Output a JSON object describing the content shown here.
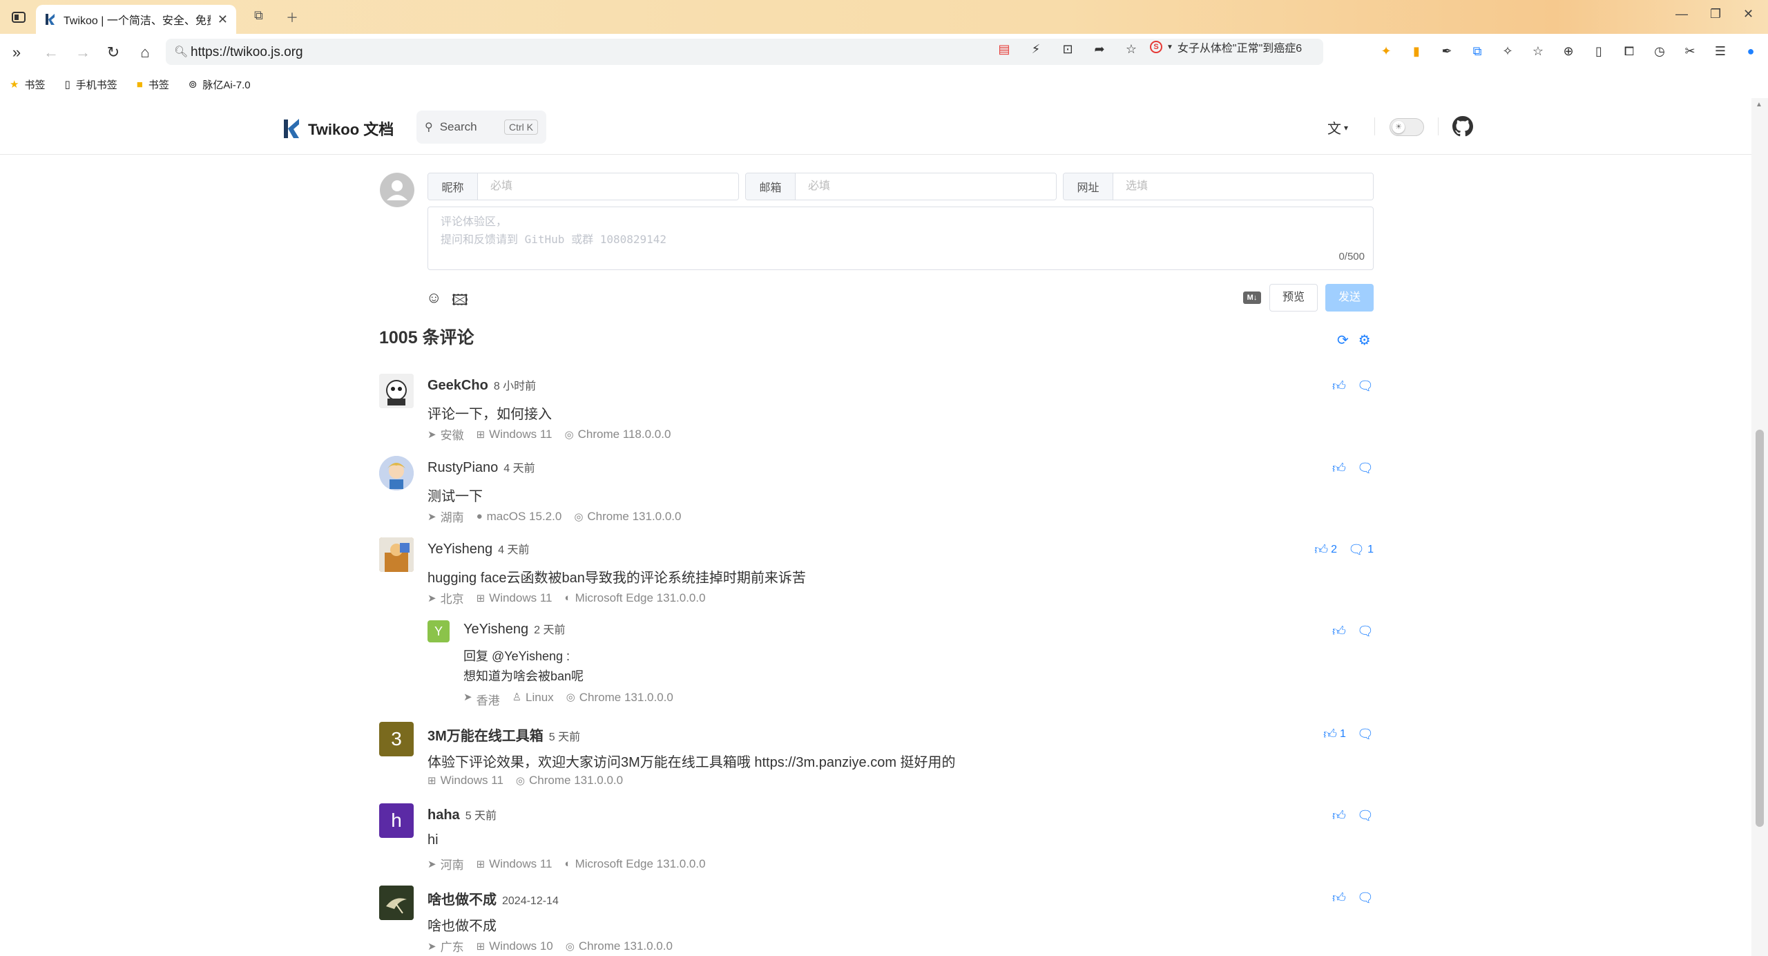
{
  "browser": {
    "tab_title": "Twikoo | 一个简洁、安全、免费",
    "url": "https://twikoo.js.org",
    "news_text": "女子从体检\"正常\"到癌症6",
    "bookmarks": [
      {
        "icon": "star-icon",
        "label": "书签"
      },
      {
        "icon": "phone-icon",
        "label": "手机书签"
      },
      {
        "icon": "folder-icon",
        "label": "书签"
      },
      {
        "icon": "bot-icon",
        "label": "脉亿Ai-7.0"
      }
    ]
  },
  "site": {
    "logo_text": "Twikoo 文档",
    "search_label": "Search",
    "search_kbd": "Ctrl K"
  },
  "form": {
    "nick_label": "昵称",
    "nick_placeholder": "必填",
    "mail_label": "邮箱",
    "mail_placeholder": "必填",
    "link_label": "网址",
    "link_placeholder": "选填",
    "textarea_placeholder": "评论体验区，\n提问和反馈请到 GitHub 或群 1080829142",
    "counter": "0/500",
    "md_label": "M↓",
    "preview_label": "预览",
    "send_label": "发送"
  },
  "comments_header": {
    "count_text": "1005 条评论"
  },
  "comments": [
    {
      "nick": "GeekCho",
      "time": "8 小时前",
      "content": "评论一下，如何接入",
      "location": "安徽",
      "os": "Windows 11",
      "browser": "Chrome 118.0.0.0",
      "likes": "",
      "replies": "",
      "avatar_letter": "",
      "avatar_color": "#e8e8e8"
    },
    {
      "nick": "RustyPiano",
      "time": "4 天前",
      "content": "测试一下",
      "location": "湖南",
      "os": "macOS 15.2.0",
      "browser": "Chrome 131.0.0.0",
      "likes": "",
      "replies": "",
      "avatar_letter": "",
      "avatar_color": "#b7c9e8"
    },
    {
      "nick": "YeYisheng",
      "time": "4 天前",
      "content": "hugging face云函数被ban导致我的评论系统挂掉时期前来诉苦",
      "location": "北京",
      "os": "Windows 11",
      "browser": "Microsoft Edge 131.0.0.0",
      "likes": "2",
      "replies": "1",
      "avatar_letter": "",
      "avatar_color": "#d9a25a"
    },
    {
      "nick": "3M万能在线工具箱",
      "time": "5 天前",
      "content": "体验下评论效果，欢迎大家访问3M万能在线工具箱哦 https://3m.panziye.com 挺好用的",
      "location": "",
      "os": "Windows 11",
      "browser": "Chrome 131.0.0.0",
      "likes": "1",
      "replies": "",
      "avatar_letter": "3",
      "avatar_color": "#7a6a1e"
    },
    {
      "nick": "haha",
      "time": "5 天前",
      "content": "hi",
      "location": "河南",
      "os": "Windows 11",
      "browser": "Microsoft Edge 131.0.0.0",
      "likes": "",
      "replies": "",
      "avatar_letter": "h",
      "avatar_color": "#5b2aa5"
    },
    {
      "nick": "啥也做不成",
      "time": "2024-12-14",
      "content": "啥也做不成",
      "location": "广东",
      "os": "Windows 10",
      "browser": "Chrome 131.0.0.0",
      "likes": "",
      "replies": "",
      "avatar_letter": "",
      "avatar_color": "#3c4a2c"
    }
  ],
  "reply": {
    "nick": "YeYisheng",
    "time": "2 天前",
    "avatar_letter": "Y",
    "reply_to": "回复 @YeYisheng :",
    "content": "想知道为啥会被ban呢",
    "location": "香港",
    "os": "Linux",
    "browser": "Chrome 131.0.0.0"
  }
}
